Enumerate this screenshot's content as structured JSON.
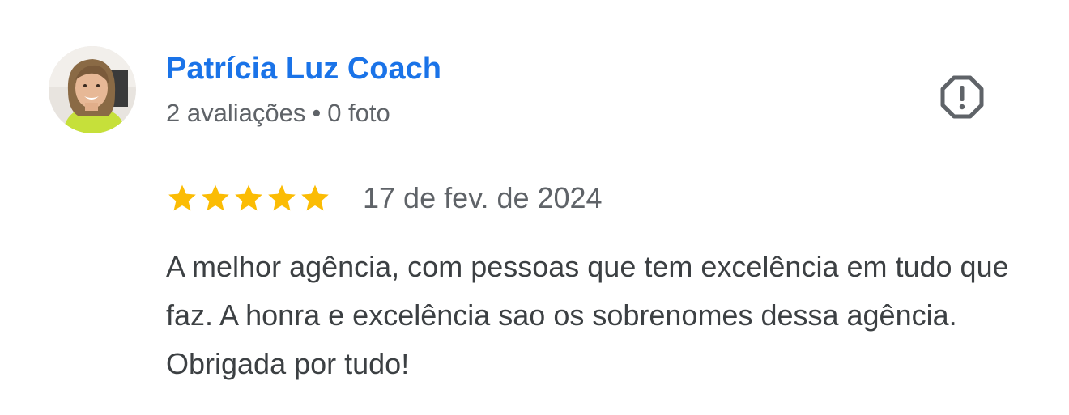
{
  "reviewer": {
    "name": "Patrícia Luz Coach",
    "reviews_count": "2 avaliações",
    "separator": "•",
    "photos_count": "0 foto"
  },
  "rating": {
    "stars": 5,
    "max": 5,
    "date": "17 de fev. de 2024",
    "star_color": "#fbbc04"
  },
  "review": {
    "text": "A melhor agência, com pessoas que tem excelência em tudo que faz. A honra e excelência sao os sobrenomes dessa agência. Obrigada por tudo!"
  },
  "icons": {
    "avatar": "reviewer-photo",
    "flag": "report-octagon-icon",
    "star": "star-icon"
  },
  "colors": {
    "name": "#1a73e8",
    "meta": "#5f6368",
    "text": "#3c4043",
    "icon": "#5f6368"
  }
}
